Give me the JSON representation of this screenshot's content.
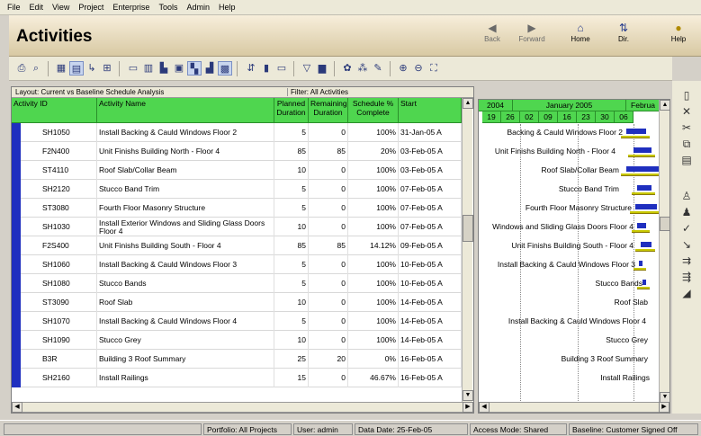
{
  "menu": [
    "File",
    "Edit",
    "View",
    "Project",
    "Enterprise",
    "Tools",
    "Admin",
    "Help"
  ],
  "header": {
    "title": "Activities",
    "back": "Back",
    "forward": "Forward",
    "home": "Home",
    "dir": "Dir.",
    "help": "Help"
  },
  "layout_label": "Layout: Current vs Baseline Schedule Analysis",
  "filter_label": "Filter: All Activities",
  "columns": {
    "activity_id": "Activity ID",
    "activity_name": "Activity Name",
    "planned_duration": "Planned Duration",
    "remaining_duration": "Remaining Duration",
    "schedule_pct": "Schedule % Complete",
    "start": "Start"
  },
  "rows": [
    {
      "id": "SH1050",
      "name": "Install Backing & Cauld Windows Floor 2",
      "planned": "5",
      "remaining": "0",
      "pct": "100%",
      "start": "31-Jan-05 A"
    },
    {
      "id": "F2N400",
      "name": "Unit Finishs Building North - Floor 4",
      "planned": "85",
      "remaining": "85",
      "pct": "20%",
      "start": "03-Feb-05 A"
    },
    {
      "id": "ST4110",
      "name": "Roof Slab/Collar Beam",
      "planned": "10",
      "remaining": "0",
      "pct": "100%",
      "start": "03-Feb-05 A"
    },
    {
      "id": "SH2120",
      "name": "Stucco Band Trim",
      "planned": "5",
      "remaining": "0",
      "pct": "100%",
      "start": "07-Feb-05 A"
    },
    {
      "id": "ST3080",
      "name": "Fourth Floor Masonry Structure",
      "planned": "5",
      "remaining": "0",
      "pct": "100%",
      "start": "07-Feb-05 A"
    },
    {
      "id": "SH1030",
      "name": "Install Exterior Windows and Sliding Glass Doors Floor 4",
      "planned": "10",
      "remaining": "0",
      "pct": "100%",
      "start": "07-Feb-05 A"
    },
    {
      "id": "F2S400",
      "name": "Unit Finishs Building South - Floor 4",
      "planned": "85",
      "remaining": "85",
      "pct": "14.12%",
      "start": "09-Feb-05 A"
    },
    {
      "id": "SH1060",
      "name": "Install Backing & Cauld Windows Floor 3",
      "planned": "5",
      "remaining": "0",
      "pct": "100%",
      "start": "10-Feb-05 A"
    },
    {
      "id": "SH1080",
      "name": "Stucco Bands",
      "planned": "5",
      "remaining": "0",
      "pct": "100%",
      "start": "10-Feb-05 A"
    },
    {
      "id": "ST3090",
      "name": "Roof Slab",
      "planned": "10",
      "remaining": "0",
      "pct": "100%",
      "start": "14-Feb-05 A"
    },
    {
      "id": "SH1070",
      "name": "Install Backing & Cauld Windows Floor 4",
      "planned": "5",
      "remaining": "0",
      "pct": "100%",
      "start": "14-Feb-05 A"
    },
    {
      "id": "SH1090",
      "name": "Stucco Grey",
      "planned": "10",
      "remaining": "0",
      "pct": "100%",
      "start": "14-Feb-05 A"
    },
    {
      "id": "B3R",
      "name": "Building 3 Roof Summary",
      "planned": "25",
      "remaining": "20",
      "pct": "0%",
      "start": "16-Feb-05 A"
    },
    {
      "id": "SH2160",
      "name": "Install Railings",
      "planned": "15",
      "remaining": "0",
      "pct": "46.67%",
      "start": "16-Feb-05 A"
    }
  ],
  "gantt": {
    "year": "2004",
    "month1": "January 2005",
    "month2": "Februa",
    "days": [
      "19",
      "26",
      "02",
      "09",
      "16",
      "23",
      "30",
      "06"
    ],
    "labels": [
      "Backing & Cauld Windows Floor 2",
      "Unit Finishs Building North - Floor 4",
      "Roof Slab/Collar Beam",
      "Stucco Band Trim",
      "Fourth Floor Masonry Structure",
      "Windows and Sliding Glass Doors Floor 4",
      "Unit Finishs Building South - Floor 4",
      "Install Backing & Cauld Windows Floor 3",
      "Stucco Bands",
      "Roof Slab",
      "Install Backing & Cauld Windows Floor 4",
      "Stucco Grey",
      "Building 3 Roof Summary",
      "Install Railings"
    ]
  },
  "status": {
    "portfolio": "Portfolio: All Projects",
    "user": "User: admin",
    "data_date": "Data Date: 25-Feb-05",
    "access": "Access Mode: Shared",
    "baseline": "Baseline: Customer Signed Off"
  }
}
